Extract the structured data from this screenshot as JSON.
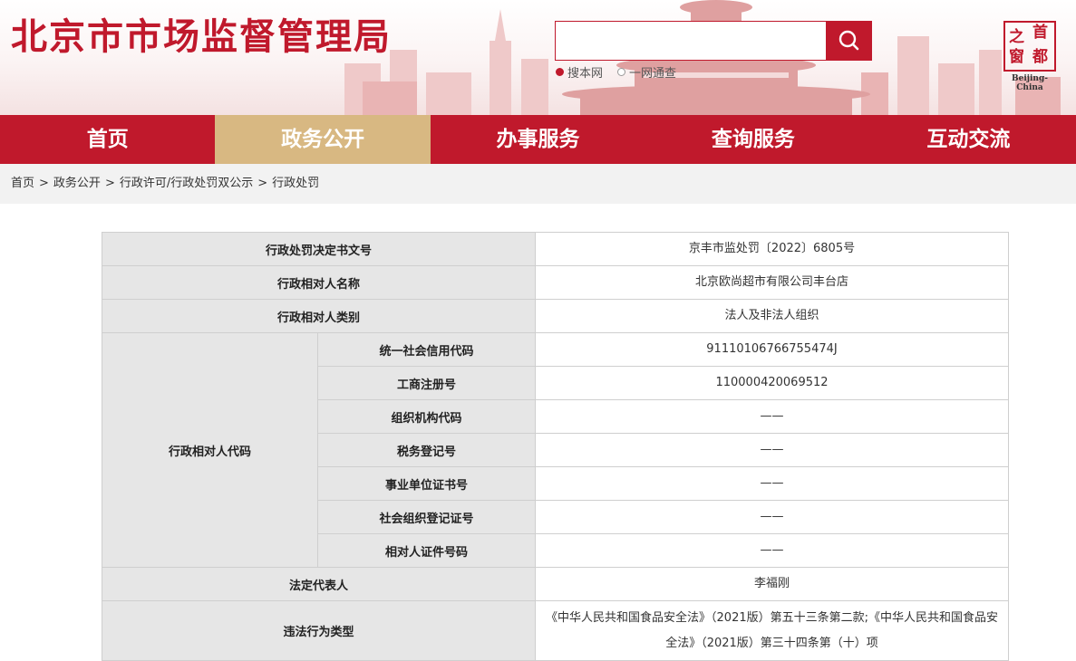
{
  "header": {
    "site_title": "北京市市场监督管理局",
    "search": {
      "placeholder": "",
      "options": [
        "搜本网",
        "一网通查"
      ]
    },
    "brand": {
      "chars": [
        "首",
        "都",
        "之",
        "窗"
      ],
      "en": "Beijing-China"
    }
  },
  "nav": {
    "items": [
      "首页",
      "政务公开",
      "办事服务",
      "查询服务",
      "互动交流"
    ],
    "active_index": 1
  },
  "breadcrumb": {
    "items": [
      "首页",
      "政务公开",
      "行政许可/行政处罚双公示",
      "行政处罚"
    ],
    "separator": ">"
  },
  "record": {
    "doc_number": {
      "label": "行政处罚决定书文号",
      "value": "京丰市监处罚〔2022〕6805号"
    },
    "party_name": {
      "label": "行政相对人名称",
      "value": "北京欧尚超市有限公司丰台店"
    },
    "party_type": {
      "label": "行政相对人类别",
      "value": "法人及非法人组织"
    },
    "party_codes": {
      "label": "行政相对人代码",
      "rows": [
        {
          "label": "统一社会信用代码",
          "value": "91110106766755474J"
        },
        {
          "label": "工商注册号",
          "value": "110000420069512"
        },
        {
          "label": "组织机构代码",
          "value": "——"
        },
        {
          "label": "税务登记号",
          "value": "——"
        },
        {
          "label": "事业单位证书号",
          "value": "——"
        },
        {
          "label": "社会组织登记证号",
          "value": "——"
        },
        {
          "label": "相对人证件号码",
          "value": "——"
        }
      ]
    },
    "legal_rep": {
      "label": "法定代表人",
      "value": "李福刚"
    },
    "violation_type": {
      "label": "违法行为类型",
      "value": "《中华人民共和国食品安全法》（2021版）第五十三条第二款;《中华人民共和国食品安全法》（2021版）第三十四条第（十）项"
    }
  },
  "colors": {
    "brand_red": "#c0192c",
    "active_nav": "#d8b882",
    "label_bg": "#e6e6e6"
  }
}
